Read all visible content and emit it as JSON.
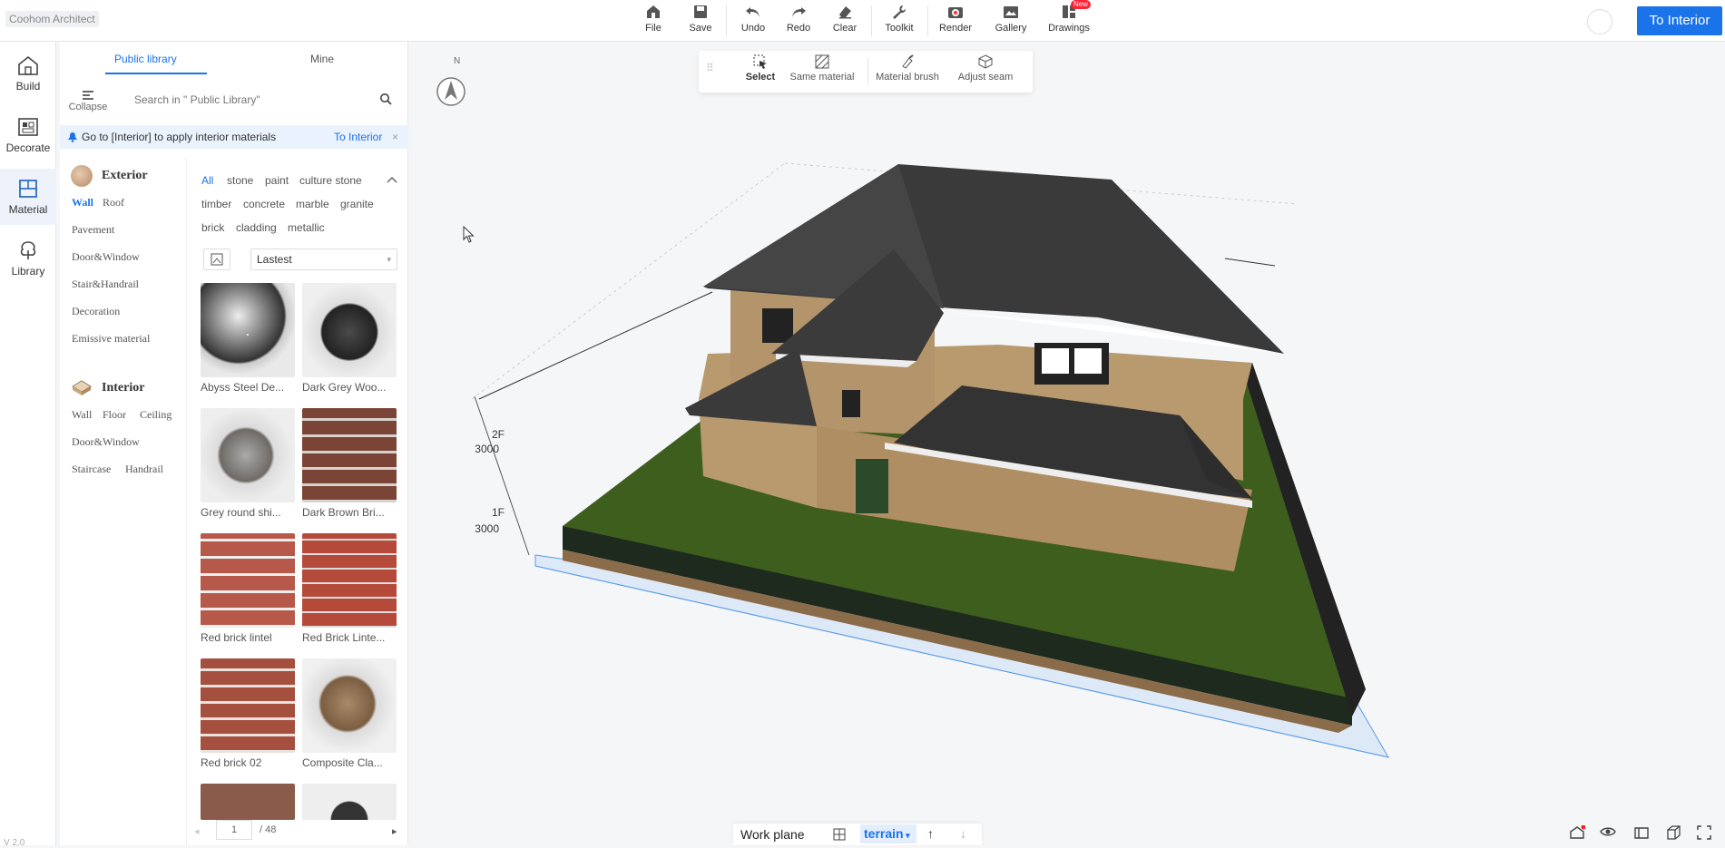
{
  "app": {
    "title": "Coohom Architect",
    "version": "V 2.0"
  },
  "toolbar": {
    "file": "File",
    "save": "Save",
    "undo": "Undo",
    "redo": "Redo",
    "clear": "Clear",
    "toolkit": "Toolkit",
    "render": "Render",
    "gallery": "Gallery",
    "drawings": "Drawings",
    "new_badge": "New",
    "to_interior": "To Interior"
  },
  "rail": {
    "build": "Build",
    "decorate": "Decorate",
    "material": "Material",
    "library": "Library"
  },
  "panel": {
    "tabs": {
      "public": "Public library",
      "mine": "Mine"
    },
    "collapse": "Collapse",
    "search_placeholder": "Search in \" Public Library\"",
    "notice": {
      "text": "Go to [Interior] to apply interior materials",
      "link": "To Interior",
      "close": "×"
    },
    "exterior": {
      "title": "Exterior",
      "items": [
        "Wall",
        "Roof",
        "Pavement",
        "Door&Window",
        "Stair&Handrail",
        "Decoration",
        "Emissive material"
      ]
    },
    "interior": {
      "title": "Interior",
      "items": [
        "Wall",
        "Floor",
        "Ceiling",
        "Door&Window",
        "Staircase",
        "Handrail"
      ]
    },
    "tags": [
      "All",
      "stone",
      "paint",
      "culture stone",
      "timber",
      "concrete",
      "marble",
      "granite",
      "brick",
      "cladding",
      "metallic"
    ],
    "sort": "Lastest",
    "materials": [
      "Abyss Steel De...",
      "Dark Grey Woo...",
      "Grey round shi...",
      "Dark Brown Bri...",
      "Red brick lintel",
      "Red Brick Linte...",
      "Red brick 02",
      "Composite Cla..."
    ],
    "pager": {
      "current": "1",
      "total": "/ 48"
    }
  },
  "viewport": {
    "compass": "N",
    "floors": [
      {
        "name": "2F",
        "height": "3000"
      },
      {
        "name": "1F",
        "height": "3000"
      }
    ],
    "subtools": {
      "select": "Select",
      "same_material": "Same material",
      "material_brush": "Material brush",
      "adjust_seam": "Adjust seam"
    },
    "bottom": {
      "work_plane": "Work plane",
      "layer": "terrain"
    }
  },
  "colors": {
    "accent": "#1a73e8",
    "roof": "#3a3a3a",
    "wall": "#b89a6e",
    "grass": "#3e5e1e",
    "badge": "#ff2233"
  }
}
